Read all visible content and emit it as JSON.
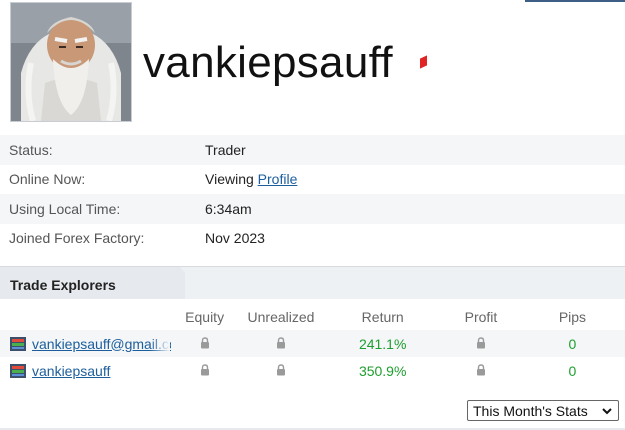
{
  "profile": {
    "username": "vankiepsauff",
    "avatar_icon": "avatar-portrait",
    "online_color": "#e02323"
  },
  "info": [
    {
      "label": "Status:",
      "value": "Trader"
    },
    {
      "label": "Online Now:",
      "value": "Viewing ",
      "link": "Profile"
    },
    {
      "label": "Using Local Time:",
      "value": "6:34am"
    },
    {
      "label": "Joined Forex Factory:",
      "value": "Nov 2023"
    }
  ],
  "trade_explorers": {
    "title": "Trade Explorers",
    "columns": [
      "Equity",
      "Unrealized",
      "Return",
      "Profit",
      "Pips"
    ],
    "rows": [
      {
        "name": "vankiepsauff@gmail.com",
        "return": "241.1%",
        "pips": "0"
      },
      {
        "name": "vankiepsauff",
        "return": "350.9%",
        "pips": "0"
      }
    ]
  },
  "stats_select": {
    "value": "This Month's Stats"
  },
  "colors": {
    "link": "#1c5e9c",
    "positive": "#1e9e2e"
  }
}
